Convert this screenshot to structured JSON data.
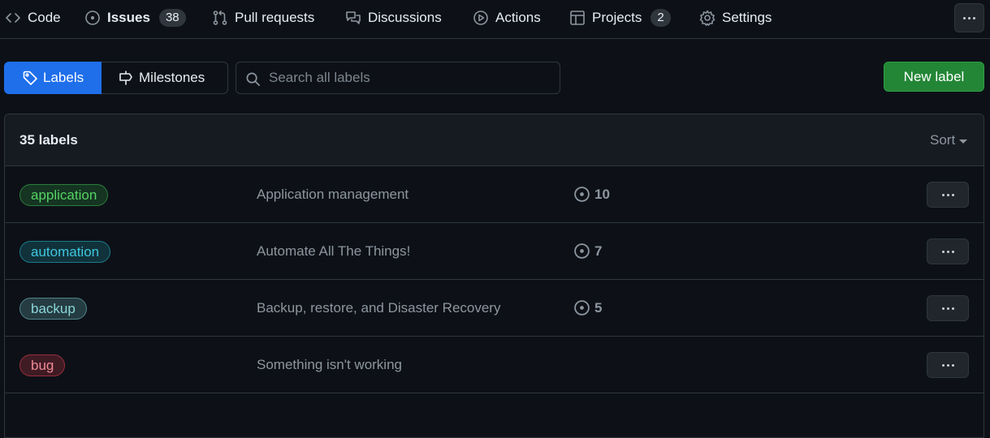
{
  "nav": {
    "items": [
      {
        "label": "Code",
        "icon": "code-icon"
      },
      {
        "label": "Issues",
        "icon": "issue-opened-icon",
        "count": "38"
      },
      {
        "label": "Pull requests",
        "icon": "git-pull-request-icon"
      },
      {
        "label": "Discussions",
        "icon": "comment-discussion-icon"
      },
      {
        "label": "Actions",
        "icon": "play-icon"
      },
      {
        "label": "Projects",
        "icon": "table-icon",
        "count": "2"
      },
      {
        "label": "Settings",
        "icon": "gear-icon"
      }
    ],
    "more_icon": "kebab-horizontal-icon"
  },
  "subnav": {
    "labels": "Labels",
    "milestones": "Milestones"
  },
  "search": {
    "placeholder": "Search all labels",
    "value": ""
  },
  "new_label_button": "New label",
  "labels_box": {
    "count": "35 labels",
    "sort": "Sort",
    "rows": [
      {
        "name": "application",
        "description": "Application management",
        "issues": "10",
        "color": "#3fb950"
      },
      {
        "name": "automation",
        "description": "Automate All The Things!",
        "issues": "7",
        "color": "#22b8cf"
      },
      {
        "name": "backup",
        "description": "Backup, restore, and Disaster Recovery",
        "issues": "5",
        "color": "#6fc0c4"
      },
      {
        "name": "bug",
        "description": "Something isn't working",
        "issues": "",
        "color": "#d73a4a"
      }
    ]
  },
  "colors": {
    "accent": "#1f6feb",
    "primary_button": "#238636",
    "background": "#0d1117",
    "border": "#30363d"
  }
}
